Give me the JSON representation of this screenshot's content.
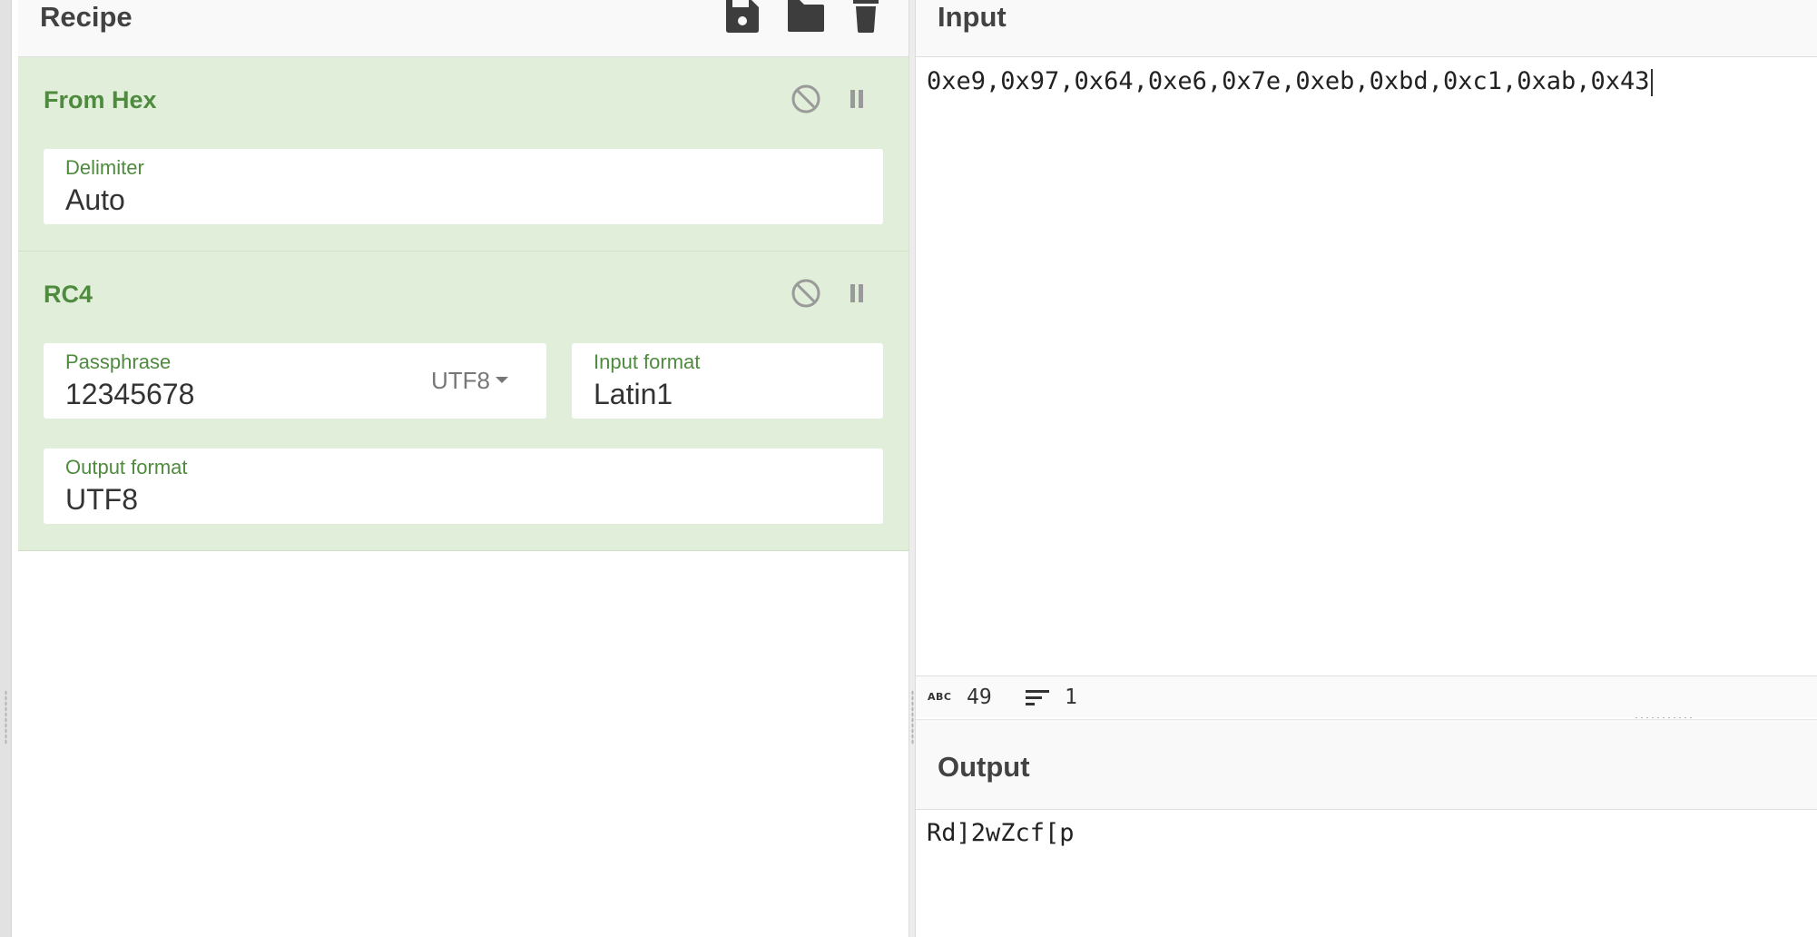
{
  "recipe": {
    "title": "Recipe",
    "header_icons": [
      "save-icon",
      "folder-icon",
      "trash-icon"
    ],
    "operations": [
      {
        "name": "From Hex",
        "fields": [
          {
            "label": "Delimiter",
            "value": "Auto"
          }
        ]
      },
      {
        "name": "RC4",
        "fields": [
          {
            "label": "Passphrase",
            "value": "12345678",
            "encoding": "UTF8"
          },
          {
            "label": "Input format",
            "value": "Latin1"
          },
          {
            "label": "Output format",
            "value": "UTF8"
          }
        ]
      }
    ]
  },
  "input": {
    "title": "Input",
    "text": "0xe9,0x97,0x64,0xe6,0x7e,0xeb,0xbd,0xc1,0xab,0x43",
    "status": {
      "chars_icon_label": "ABC",
      "chars": "49",
      "lines": "1"
    }
  },
  "output": {
    "title": "Output",
    "text": "Rd]2wZcf[p"
  },
  "colors": {
    "op_background": "#e1eed9",
    "op_accent": "#4e8b3e",
    "header_background": "#f9f9f9"
  }
}
